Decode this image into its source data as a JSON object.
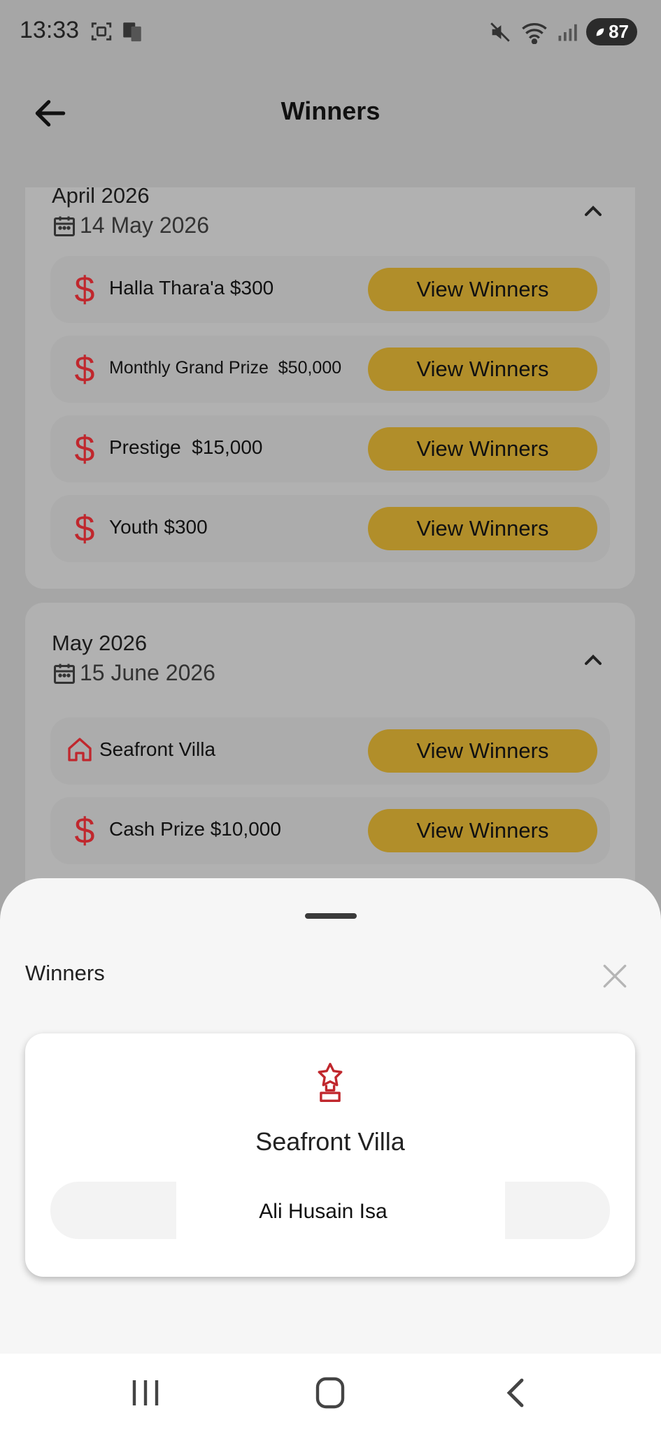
{
  "status_bar": {
    "time": "13:33",
    "battery": "87"
  },
  "header": {
    "title": "Winners"
  },
  "groups": [
    {
      "month": "April 2026",
      "draw_date": "14 May 2026",
      "prizes": [
        {
          "label": "Halla Thara'a $300",
          "icon": "dollar-icon",
          "button": "View Winners"
        },
        {
          "label": "Monthly Grand Prize  $50,000",
          "icon": "dollar-icon",
          "button": "View Winners"
        },
        {
          "label": "Prestige  $15,000",
          "icon": "dollar-icon",
          "button": "View Winners"
        },
        {
          "label": "Youth $300",
          "icon": "dollar-icon",
          "button": "View Winners"
        }
      ]
    },
    {
      "month": "May 2026",
      "draw_date": "15 June 2026",
      "prizes": [
        {
          "label": "Seafront Villa",
          "icon": "house-icon",
          "button": "View Winners"
        },
        {
          "label": "Cash Prize $10,000",
          "icon": "dollar-icon",
          "button": "View Winners"
        }
      ]
    }
  ],
  "sheet": {
    "title": "Winners",
    "prize_name": "Seafront Villa",
    "winners": [
      "Ali Husain Isa"
    ]
  },
  "colors": {
    "accent": "#b18e2a",
    "icon_red": "#c0272d"
  }
}
